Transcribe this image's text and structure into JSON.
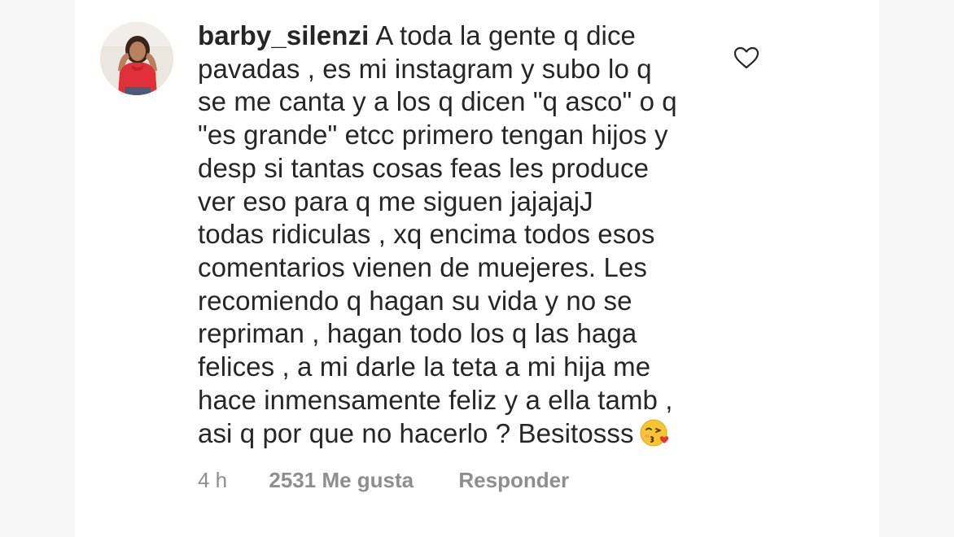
{
  "comment": {
    "username": "barby_silenzi",
    "lines": [
      "A toda la gente q dice",
      "pavadas , es mi instagram y subo lo q",
      "se me canta y a los q dicen \"q asco\" o q",
      "\"es grande\" etcc primero tengan hijos y",
      "desp si tantas cosas feas les produce",
      "ver eso para q me siguen jajajajJ",
      "todas ridiculas , xq encima todos esos",
      "comentarios vienen de muejeres. Les",
      "recomiendo q hagan su vida y no se",
      "repriman , hagan todo los q las haga",
      "felices , a mi darle la teta a mi hija me",
      "hace inmensamente feliz y a ella tamb ,",
      "asi q por que no hacerlo ? Besitosss"
    ],
    "emoji": "kissing-face-with-heart-emoji"
  },
  "meta": {
    "time": "4 h",
    "likes": "2531 Me gusta",
    "reply": "Responder"
  },
  "icons": {
    "like": "heart-outline-icon"
  },
  "colors": {
    "text": "#262626",
    "secondary": "#8e8e8e",
    "background": "#ffffff"
  }
}
